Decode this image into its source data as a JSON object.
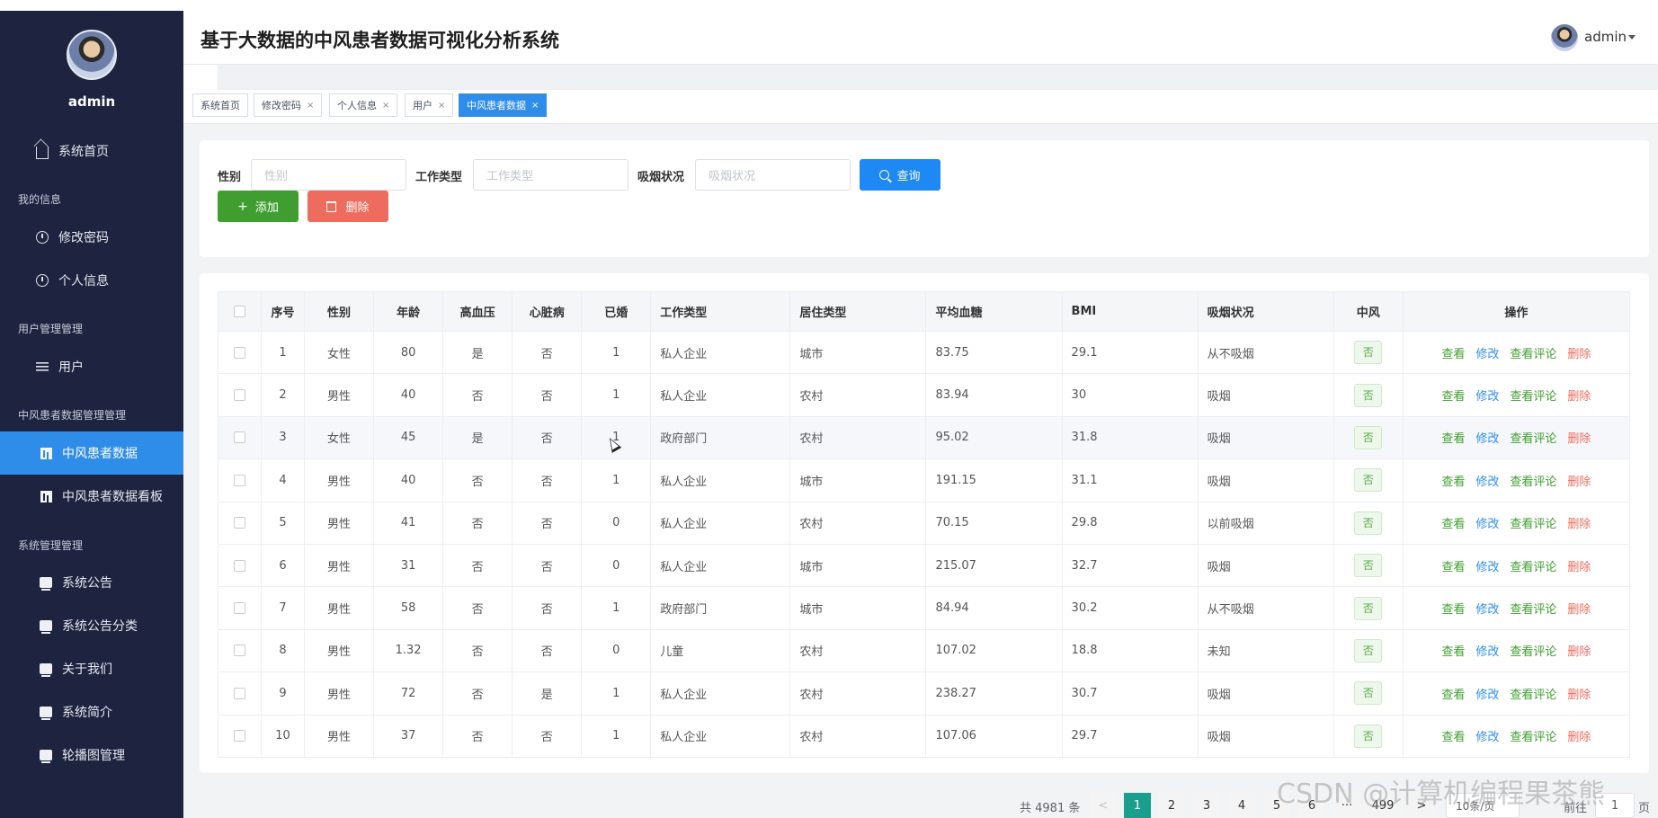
{
  "app": {
    "title": "基于大数据的中风患者数据可视化分析系统",
    "user": "admin"
  },
  "sidebar": {
    "username": "admin",
    "items": [
      {
        "label": "系统首页",
        "icon": "home-icon"
      },
      {
        "group": "我的信息"
      },
      {
        "label": "修改密码",
        "icon": "clock-icon"
      },
      {
        "label": "个人信息",
        "icon": "clock-icon"
      },
      {
        "group": "用户管理管理"
      },
      {
        "label": "用户",
        "icon": "sliders-icon"
      },
      {
        "group": "中风患者数据管理管理"
      },
      {
        "label": "中风患者数据",
        "icon": "chart-icon",
        "active": true
      },
      {
        "label": "中风患者数据看板",
        "icon": "chart-icon"
      },
      {
        "group": "系统管理管理"
      },
      {
        "label": "系统公告",
        "icon": "doc-icon"
      },
      {
        "label": "系统公告分类",
        "icon": "doc-icon"
      },
      {
        "label": "关于我们",
        "icon": "doc-icon"
      },
      {
        "label": "系统简介",
        "icon": "doc-icon"
      },
      {
        "label": "轮播图管理",
        "icon": "doc-icon"
      }
    ]
  },
  "tags": [
    {
      "label": "系统首页",
      "closable": false
    },
    {
      "label": "修改密码",
      "closable": true
    },
    {
      "label": "个人信息",
      "closable": true
    },
    {
      "label": "用户",
      "closable": true
    },
    {
      "label": "中风患者数据",
      "closable": true,
      "active": true
    }
  ],
  "search": {
    "gender_label": "性别",
    "gender_placeholder": "性别",
    "job_label": "工作类型",
    "job_placeholder": "工作类型",
    "smoke_label": "吸烟状况",
    "smoke_placeholder": "吸烟状况",
    "search_button": "查询",
    "add_button": "添加",
    "delete_button": "删除"
  },
  "table": {
    "headers": [
      "序号",
      "性别",
      "年龄",
      "高血压",
      "心脏病",
      "已婚",
      "工作类型",
      "居住类型",
      "平均血糖",
      "BMI",
      "吸烟状况",
      "中风",
      "操作"
    ],
    "actions": {
      "view": "查看",
      "edit": "修改",
      "review": "查看评论",
      "delete": "删除"
    },
    "rows": [
      [
        "1",
        "女性",
        "80",
        "是",
        "否",
        "1",
        "私人企业",
        "城市",
        "83.75",
        "29.1",
        "从不吸烟",
        "否"
      ],
      [
        "2",
        "男性",
        "40",
        "否",
        "否",
        "1",
        "私人企业",
        "农村",
        "83.94",
        "30",
        "吸烟",
        "否"
      ],
      [
        "3",
        "女性",
        "45",
        "是",
        "否",
        "1",
        "政府部门",
        "农村",
        "95.02",
        "31.8",
        "吸烟",
        "否"
      ],
      [
        "4",
        "男性",
        "40",
        "否",
        "否",
        "1",
        "私人企业",
        "城市",
        "191.15",
        "31.1",
        "吸烟",
        "否"
      ],
      [
        "5",
        "男性",
        "41",
        "否",
        "否",
        "0",
        "私人企业",
        "农村",
        "70.15",
        "29.8",
        "以前吸烟",
        "否"
      ],
      [
        "6",
        "男性",
        "31",
        "否",
        "否",
        "0",
        "私人企业",
        "城市",
        "215.07",
        "32.7",
        "吸烟",
        "否"
      ],
      [
        "7",
        "男性",
        "58",
        "否",
        "否",
        "1",
        "政府部门",
        "城市",
        "84.94",
        "30.2",
        "从不吸烟",
        "否"
      ],
      [
        "8",
        "男性",
        "1.32",
        "否",
        "否",
        "0",
        "儿童",
        "农村",
        "107.02",
        "18.8",
        "未知",
        "否"
      ],
      [
        "9",
        "男性",
        "72",
        "否",
        "是",
        "1",
        "私人企业",
        "农村",
        "238.27",
        "30.7",
        "吸烟",
        "否"
      ],
      [
        "10",
        "男性",
        "37",
        "否",
        "否",
        "1",
        "私人企业",
        "农村",
        "107.06",
        "29.7",
        "吸烟",
        "否"
      ]
    ]
  },
  "pagination": {
    "total": "共 4981 条",
    "prev": "<",
    "next": ">",
    "pages": [
      "1",
      "2",
      "3",
      "4",
      "5",
      "6"
    ],
    "ellipsis": "···",
    "last": "499",
    "current": "1",
    "page_size": "10条/页",
    "goto_label": "前往",
    "goto_value": "1",
    "goto_suffix": "页"
  },
  "watermark": "CSDN @计算机编程果茶熊",
  "colors": {
    "sidebar_bg": "#1e2440",
    "active_blue": "#2f8dea",
    "green": "#3f9e2f",
    "red": "#ee6c5e",
    "pager_active": "#1a9f8f"
  }
}
